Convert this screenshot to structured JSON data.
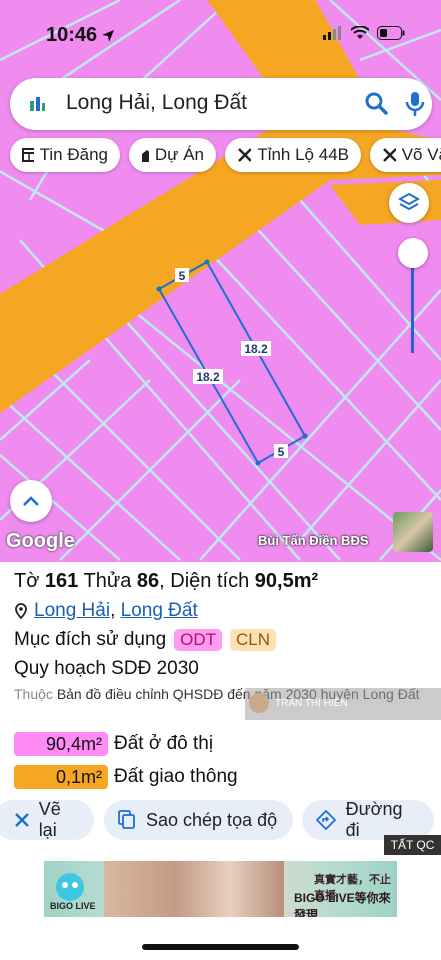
{
  "status": {
    "time": "10:46"
  },
  "search": {
    "query": "Long Hải, Long Đất"
  },
  "chips": [
    "Tin Đăng",
    "Dự Án",
    "Tỉnh Lộ 44B",
    "Võ Vă"
  ],
  "map": {
    "colors": {
      "residential": "#f08cf0",
      "road": "#f5a623",
      "parcel_line": "#1f6fd1",
      "grid_line": "#bfe8f0"
    },
    "dimensions": {
      "top": "5",
      "bottom": "5",
      "left": "18.2",
      "right": "18.2"
    },
    "google_label": "Google",
    "author": "Bùi Tấn Điền BĐS"
  },
  "parcel": {
    "to_label": "Tờ",
    "to_value": "161",
    "thua_label": "Thửa",
    "thua_value": "86",
    "area_label": "Diện tích",
    "area_value": "90,5m²",
    "locations": [
      "Long Hải",
      "Long Đất"
    ],
    "purpose_label": "Mục đích sử dụng",
    "purpose_tags": [
      "ODT",
      "CLN"
    ],
    "plan_label": "Quy hoạch SDĐ 2030",
    "belongs_prefix": "Thuộc",
    "belongs_text": "Bản đồ điều chỉnh QHSDĐ đến năm 2030 huyện Long Đất",
    "watermark_text": "TRẦN THỊ HIỀN",
    "land_uses": [
      {
        "area": "90,4m²",
        "name": "Đất ở đô thị",
        "color": "#ff8cf5"
      },
      {
        "area": "0,1m²",
        "name": "Đất giao thông",
        "color": "#f5a623"
      }
    ]
  },
  "actions": {
    "redraw": "Vẽ lại",
    "copy": "Sao chép tọa độ",
    "directions": "Đường đi"
  },
  "ad": {
    "close_label": "TẤT QC",
    "brand": "BIGO LIVE",
    "line1": "真實才藝，不止直播",
    "line2": "BIGO LIVE等你來發現"
  }
}
